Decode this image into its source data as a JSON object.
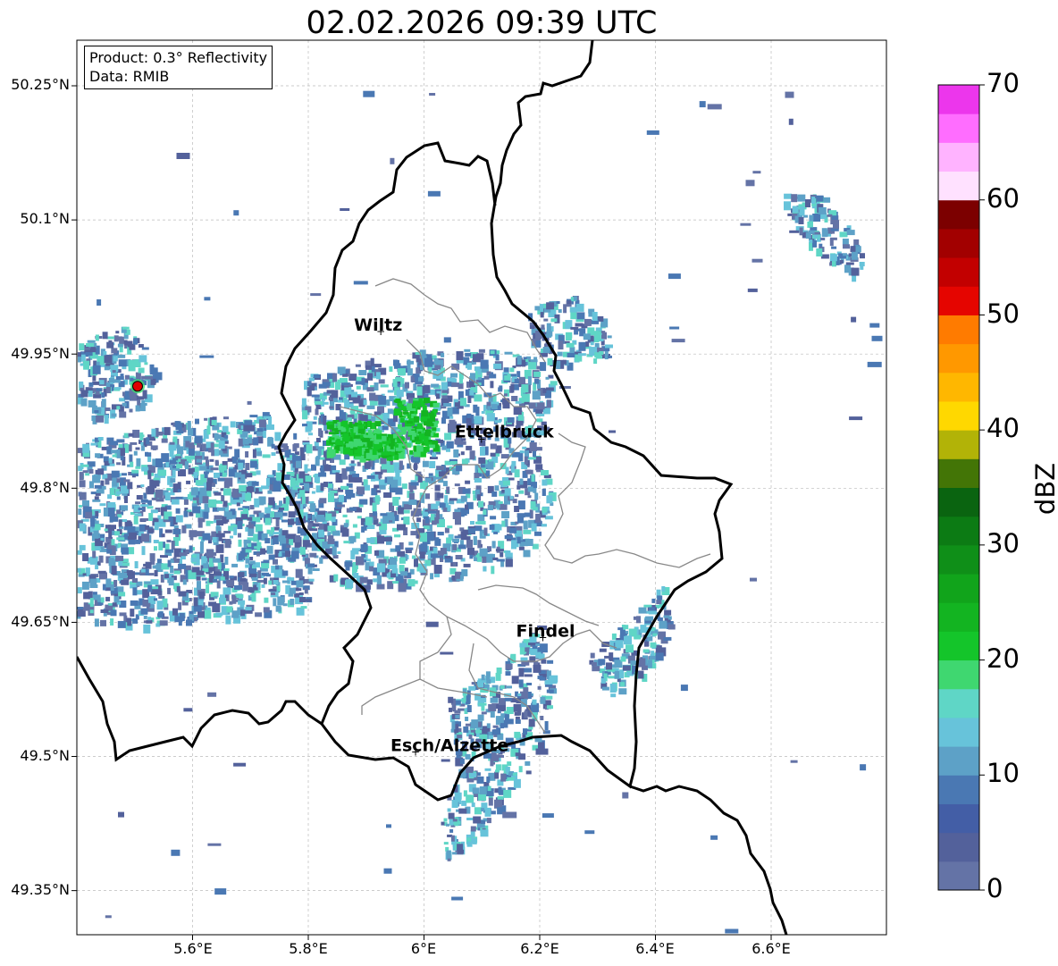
{
  "title": "02.02.2026 09:39 UTC",
  "info": {
    "product": "Product: 0.3° Reflectivity",
    "data": "Data: RMIB"
  },
  "axes": {
    "lat_ticks": [
      "50.25°N",
      "50.1°N",
      "49.95°N",
      "49.8°N",
      "49.65°N",
      "49.5°N",
      "49.35°N"
    ],
    "lon_ticks": [
      "5.6°E",
      "5.8°E",
      "6°E",
      "6.2°E",
      "6.4°E",
      "6.6°E"
    ]
  },
  "colorbar": {
    "label": "dBZ",
    "ticks": [
      "0",
      "10",
      "20",
      "30",
      "40",
      "50",
      "60",
      "70"
    ],
    "colors": [
      "#6473a6",
      "#53619b",
      "#435ea6",
      "#4a78b3",
      "#5da1c7",
      "#67c3da",
      "#5fd6c6",
      "#3fd770",
      "#14c52a",
      "#13b421",
      "#11a41b",
      "#0f8f18",
      "#0c7b14",
      "#0a6410",
      "#437506",
      "#b2b307",
      "#ffd800",
      "#ffb700",
      "#ff9800",
      "#ff7b00",
      "#e50500",
      "#c20000",
      "#a20000",
      "#7c0000",
      "#ffe1ff",
      "#ffb3ff",
      "#ff6dff",
      "#ec36ec"
    ]
  },
  "cities": [
    {
      "name": "Wiltz",
      "lon": 5.93,
      "lat": 49.968
    },
    {
      "name": "Ettelbruck",
      "lon": 6.104,
      "lat": 49.848
    },
    {
      "name": "Findel",
      "lon": 6.21,
      "lat": 49.626
    },
    {
      "name": "Esch/Alzette",
      "lon": 5.99,
      "lat": 49.498
    }
  ],
  "radar_site": {
    "lon": 5.505,
    "lat": 49.914
  }
}
